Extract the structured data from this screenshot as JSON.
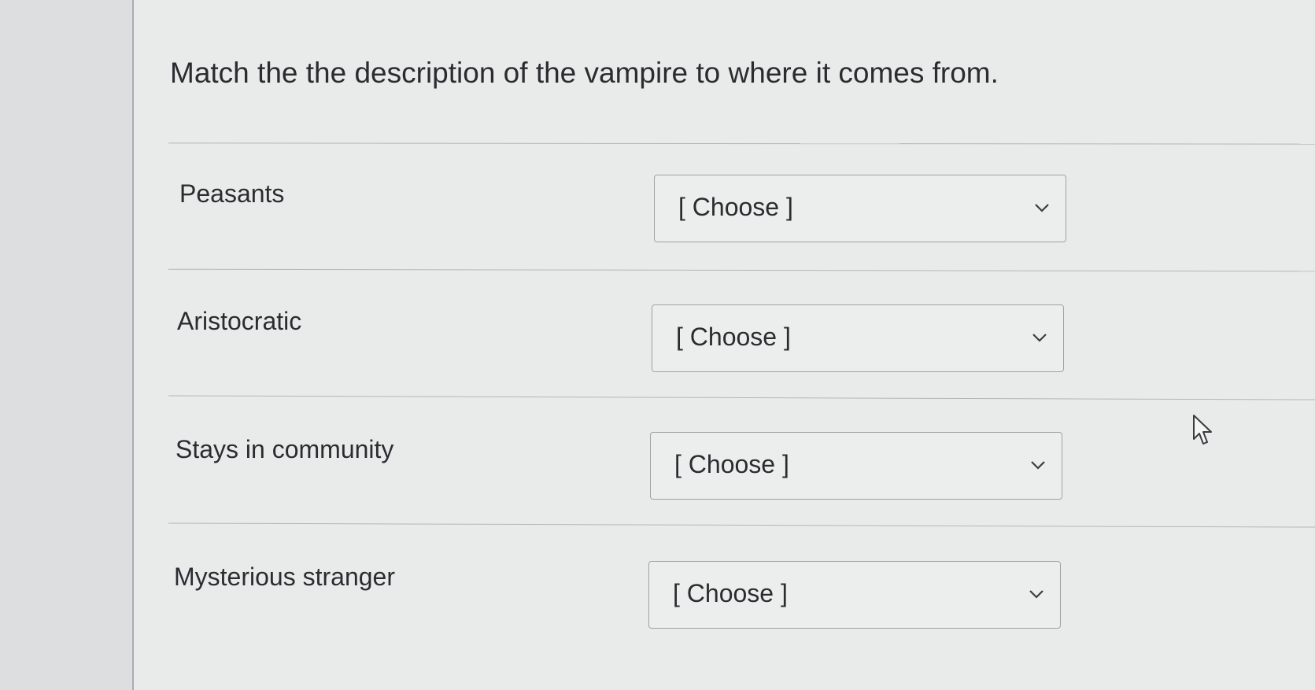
{
  "question": {
    "text": "Match the the description of the vampire to where it comes from."
  },
  "rows": [
    {
      "label": "Peasants",
      "selected": "[ Choose ]"
    },
    {
      "label": "Aristocratic",
      "selected": "[ Choose ]"
    },
    {
      "label": "Stays in community",
      "selected": "[ Choose ]"
    },
    {
      "label": "Mysterious stranger",
      "selected": "[ Choose ]"
    }
  ],
  "icons": {
    "dropdown": "chevron-down-icon",
    "pointer": "mouse-pointer-icon"
  }
}
